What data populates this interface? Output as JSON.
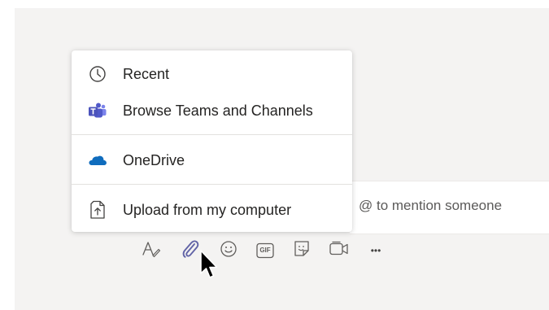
{
  "compose": {
    "placeholder": "@ to mention someone"
  },
  "attach_menu": {
    "items": [
      {
        "label": "Recent",
        "icon": "clock-icon"
      },
      {
        "label": "Browse Teams and Channels",
        "icon": "teams-icon"
      },
      {
        "label": "OneDrive",
        "icon": "onedrive-cloud-icon"
      },
      {
        "label": "Upload from my computer",
        "icon": "upload-file-icon"
      }
    ]
  },
  "toolbar": {
    "buttons": [
      {
        "name": "format",
        "icon": "format-text-icon"
      },
      {
        "name": "attach",
        "icon": "paperclip-icon",
        "active": true
      },
      {
        "name": "emoji",
        "icon": "emoji-icon"
      },
      {
        "name": "gif",
        "icon": "gif-icon",
        "label": "GIF"
      },
      {
        "name": "sticker",
        "icon": "sticker-icon"
      },
      {
        "name": "meet-now",
        "icon": "video-camera-icon"
      },
      {
        "name": "more",
        "icon": "more-options-icon",
        "label": "•••"
      }
    ]
  },
  "colors": {
    "panel_bg": "#f4f3f2",
    "accent": "#6264a7",
    "text": "#252423",
    "icon_gray": "#605e5c",
    "onedrive": "#0f6cbd"
  }
}
